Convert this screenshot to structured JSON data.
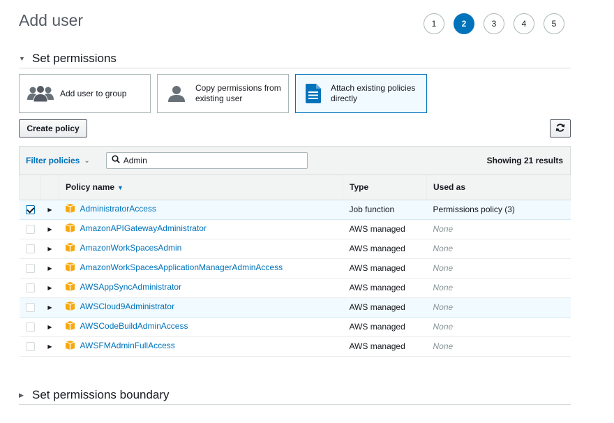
{
  "page": {
    "title": "Add user"
  },
  "steps": [
    {
      "label": "1",
      "active": false
    },
    {
      "label": "2",
      "active": true
    },
    {
      "label": "3",
      "active": false
    },
    {
      "label": "4",
      "active": false
    },
    {
      "label": "5",
      "active": false
    }
  ],
  "permissions": {
    "section_title": "Set permissions",
    "options": [
      {
        "icon": "user-group-icon",
        "label": "Add user to group",
        "selected": false
      },
      {
        "icon": "user-icon",
        "label": "Copy permissions from existing user",
        "selected": false
      },
      {
        "icon": "document-icon",
        "label": "Attach existing policies directly",
        "selected": true
      }
    ],
    "create_policy_label": "Create policy",
    "refresh_icon": "refresh-icon"
  },
  "filter": {
    "label": "Filter policies",
    "search_value": "Admin",
    "results": "Showing 21 results"
  },
  "table": {
    "columns": {
      "name": "Policy name",
      "type": "Type",
      "used_as": "Used as"
    },
    "rows": [
      {
        "checked": true,
        "name": "AdministratorAccess",
        "type": "Job function",
        "used_as": "Permissions policy (3)",
        "used_muted": false,
        "highlight": true
      },
      {
        "checked": false,
        "name": "AmazonAPIGatewayAdministrator",
        "type": "AWS managed",
        "used_as": "None",
        "used_muted": true,
        "highlight": false
      },
      {
        "checked": false,
        "name": "AmazonWorkSpacesAdmin",
        "type": "AWS managed",
        "used_as": "None",
        "used_muted": true,
        "highlight": false
      },
      {
        "checked": false,
        "name": "AmazonWorkSpacesApplicationManagerAdminAccess",
        "type": "AWS managed",
        "used_as": "None",
        "used_muted": true,
        "highlight": false
      },
      {
        "checked": false,
        "name": "AWSAppSyncAdministrator",
        "type": "AWS managed",
        "used_as": "None",
        "used_muted": true,
        "highlight": false
      },
      {
        "checked": false,
        "name": "AWSCloud9Administrator",
        "type": "AWS managed",
        "used_as": "None",
        "used_muted": true,
        "highlight": true
      },
      {
        "checked": false,
        "name": "AWSCodeBuildAdminAccess",
        "type": "AWS managed",
        "used_as": "None",
        "used_muted": true,
        "highlight": false
      },
      {
        "checked": false,
        "name": "AWSFMAdminFullAccess",
        "type": "AWS managed",
        "used_as": "None",
        "used_muted": true,
        "highlight": false
      }
    ]
  },
  "boundary": {
    "section_title": "Set permissions boundary"
  },
  "colors": {
    "accent": "#0073bb",
    "package_icon": "#f7a80d"
  }
}
